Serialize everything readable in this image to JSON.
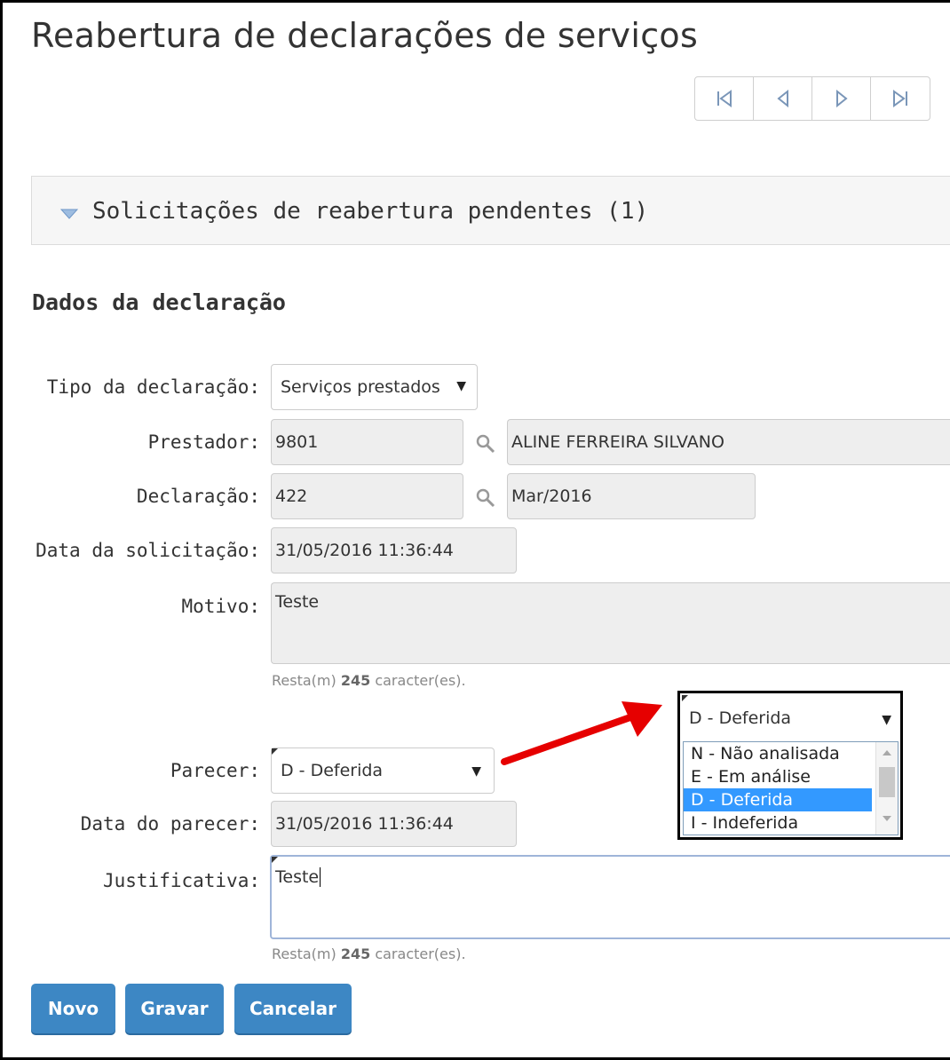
{
  "page": {
    "title": "Reabertura de declarações de serviços"
  },
  "pager": {
    "icons": [
      "first-page-icon",
      "previous-page-icon",
      "next-page-icon",
      "last-page-icon"
    ]
  },
  "pending_panel": {
    "label": "Solicitações de reabertura pendentes (1)"
  },
  "section": {
    "title": "Dados da declaração"
  },
  "form": {
    "tipo": {
      "label": "Tipo da declaração:",
      "value": "Serviços prestados"
    },
    "prestador": {
      "label": "Prestador:",
      "code": "9801",
      "name": "ALINE FERREIRA SILVANO"
    },
    "declaracao": {
      "label": "Declaração:",
      "code": "422",
      "period": "Mar/2016"
    },
    "data_solicitacao": {
      "label": "Data da solicitação:",
      "value": "31/05/2016 11:36:44"
    },
    "motivo": {
      "label": "Motivo:",
      "value": "Teste",
      "remaining_prefix": "Resta(m)",
      "remaining_count": "245",
      "remaining_suffix": "caracter(es)."
    },
    "parecer": {
      "label": "Parecer:",
      "value": "D - Deferida"
    },
    "data_parecer": {
      "label": "Data do parecer:",
      "value": "31/05/2016 11:36:44"
    },
    "justificativa": {
      "label": "Justificativa:",
      "value": "Teste",
      "remaining_prefix": "Resta(m)",
      "remaining_count": "245",
      "remaining_suffix": "caracter(es)."
    }
  },
  "buttons": {
    "novo": "Novo",
    "gravar": "Gravar",
    "cancelar": "Cancelar"
  },
  "dropdown_callout": {
    "selected": "D - Deferida",
    "options": [
      "N - Não analisada",
      "E - Em análise",
      "D - Deferida",
      "I - Indeferida"
    ],
    "selected_index": 2
  },
  "colors": {
    "button_bg": "#3d87c4",
    "arrow": "#e60000",
    "selected_option_bg": "#3399ff"
  }
}
